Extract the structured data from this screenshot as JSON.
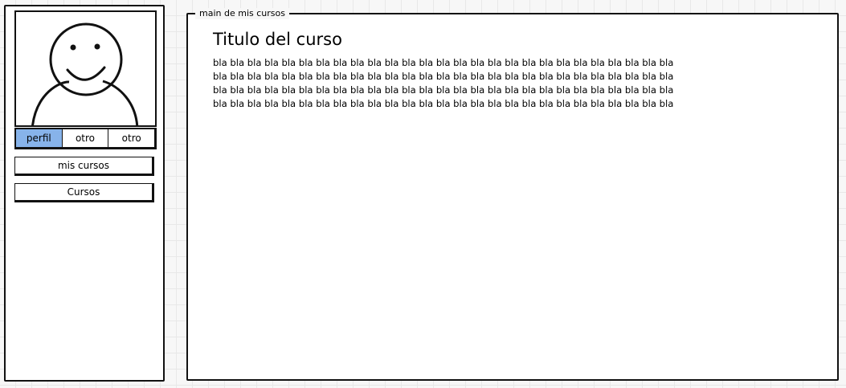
{
  "sidebar": {
    "tabs": [
      {
        "label": "perfil",
        "active": true
      },
      {
        "label": "otro",
        "active": false
      },
      {
        "label": "otro",
        "active": false
      }
    ],
    "buttons": {
      "mis_cursos": "mis cursos",
      "cursos": "Cursos"
    }
  },
  "main": {
    "legend": "main de mis cursos",
    "title": "Titulo del curso",
    "body": "bla bla bla bla bla bla bla bla bla bla bla bla bla bla bla bla bla bla bla bla bla bla bla bla bla bla bla bla bla bla bla bla bla bla bla bla bla bla bla bla bla bla bla bla bla bla bla bla bla bla bla bla bla bla bla bla bla bla bla bla bla bla bla bla bla bla bla bla bla bla bla bla bla bla bla bla bla bla bla bla bla bla bla bla bla bla bla bla bla bla bla bla bla bla bla bla bla bla bla bla bla bla bla bla bla bla bla bla"
  },
  "colors": {
    "active_tab": "#87b3ea",
    "border": "#111111",
    "background": "#f7f7f7"
  }
}
